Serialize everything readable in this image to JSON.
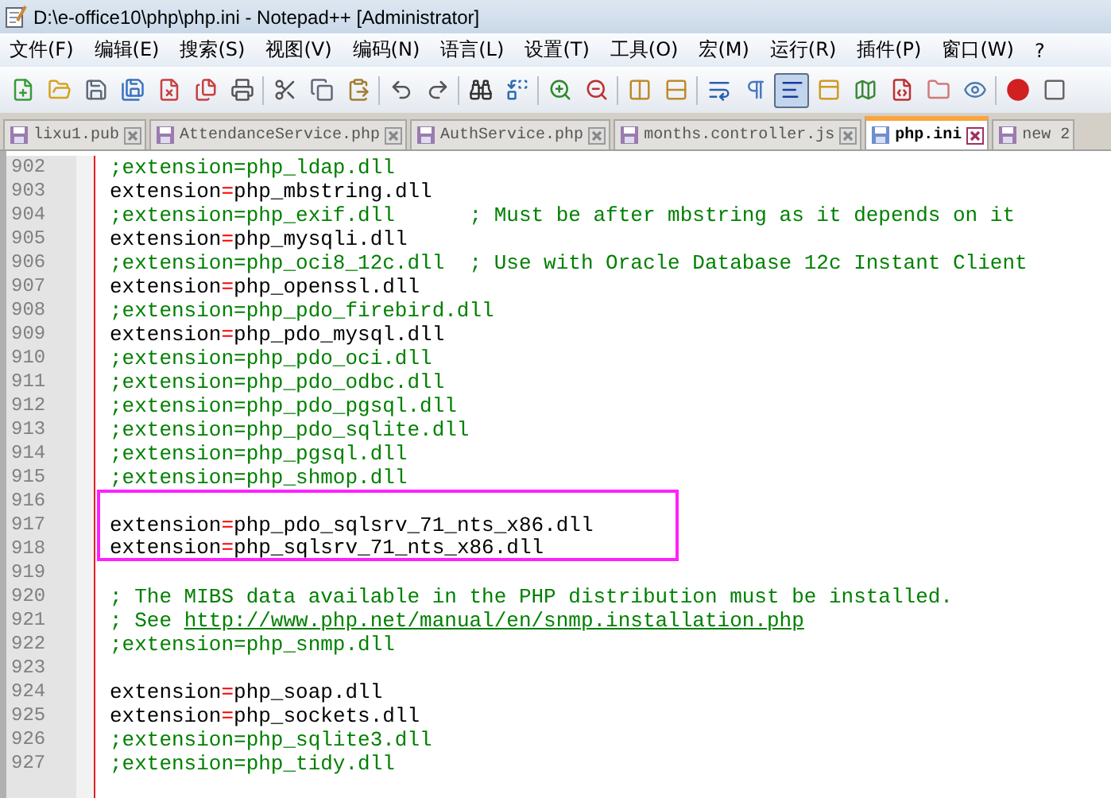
{
  "window": {
    "title": "D:\\e-office10\\php\\php.ini - Notepad++ [Administrator]"
  },
  "menu": [
    "文件(F)",
    "编辑(E)",
    "搜索(S)",
    "视图(V)",
    "编码(N)",
    "语言(L)",
    "设置(T)",
    "工具(O)",
    "宏(M)",
    "运行(R)",
    "插件(P)",
    "窗口(W)",
    "?"
  ],
  "toolbar": [
    {
      "pressed": false
    },
    {
      "pressed": false
    },
    {
      "pressed": false
    },
    {
      "pressed": false
    },
    {
      "pressed": false
    },
    {
      "pressed": false
    },
    {
      "pressed": false
    },
    {
      "pressed": false
    },
    {
      "pressed": false
    },
    {
      "pressed": false
    },
    {
      "pressed": false
    },
    {
      "pressed": false
    },
    {
      "pressed": false
    },
    {
      "pressed": false
    },
    {
      "pressed": false
    },
    {
      "pressed": false
    },
    {
      "pressed": false
    },
    {
      "pressed": false
    },
    {
      "pressed": false
    },
    {
      "pressed": false
    },
    {
      "pressed": true
    },
    {
      "pressed": false
    },
    {
      "pressed": false
    },
    {
      "pressed": false
    },
    {
      "pressed": false
    },
    {
      "pressed": false
    },
    {
      "pressed": false
    },
    {
      "pressed": false
    }
  ],
  "tabs": [
    {
      "label": "lixu1.pub",
      "selected": false
    },
    {
      "label": "AttendanceService.php",
      "selected": false
    },
    {
      "label": "AuthService.php",
      "selected": false
    },
    {
      "label": "months.controller.js",
      "selected": false
    },
    {
      "label": "php.ini",
      "selected": true
    },
    {
      "label": "new 2",
      "selected": false
    }
  ],
  "lines": [
    {
      "number": "902",
      "kind": "comment",
      "text": ";extension=php_ldap.dll",
      "boxed": false
    },
    {
      "number": "903",
      "kind": "setting",
      "key": "extension",
      "op": "=",
      "value": "php_mbstring.dll",
      "boxed": false
    },
    {
      "number": "904",
      "kind": "comment",
      "text": ";extension=php_exif.dll      ; Must be after mbstring as it depends on it",
      "boxed": false
    },
    {
      "number": "905",
      "kind": "setting",
      "key": "extension",
      "op": "=",
      "value": "php_mysqli.dll",
      "boxed": false
    },
    {
      "number": "906",
      "kind": "comment",
      "text": ";extension=php_oci8_12c.dll  ; Use with Oracle Database 12c Instant Client",
      "boxed": false
    },
    {
      "number": "907",
      "kind": "setting",
      "key": "extension",
      "op": "=",
      "value": "php_openssl.dll",
      "boxed": false
    },
    {
      "number": "908",
      "kind": "comment",
      "text": ";extension=php_pdo_firebird.dll",
      "boxed": false
    },
    {
      "number": "909",
      "kind": "setting",
      "key": "extension",
      "op": "=",
      "value": "php_pdo_mysql.dll",
      "boxed": false
    },
    {
      "number": "910",
      "kind": "comment",
      "text": ";extension=php_pdo_oci.dll",
      "boxed": false
    },
    {
      "number": "911",
      "kind": "comment",
      "text": ";extension=php_pdo_odbc.dll",
      "boxed": false
    },
    {
      "number": "912",
      "kind": "comment",
      "text": ";extension=php_pdo_pgsql.dll",
      "boxed": false
    },
    {
      "number": "913",
      "kind": "comment",
      "text": ";extension=php_pdo_sqlite.dll",
      "boxed": false
    },
    {
      "number": "914",
      "kind": "comment",
      "text": ";extension=php_pgsql.dll",
      "boxed": false
    },
    {
      "number": "915",
      "kind": "comment",
      "text": ";extension=php_shmop.dll",
      "boxed": false
    },
    {
      "number": "916",
      "kind": "blank",
      "boxed": true
    },
    {
      "number": "917",
      "kind": "setting",
      "key": "extension",
      "op": "=",
      "value": "php_pdo_sqlsrv_71_nts_x86.dll",
      "boxed": true
    },
    {
      "number": "918",
      "kind": "setting",
      "key": "extension",
      "op": "=",
      "value": "php_sqlsrv_71_nts_x86.dll",
      "boxed": true
    },
    {
      "number": "919",
      "kind": "blank",
      "boxed": false
    },
    {
      "number": "920",
      "kind": "comment",
      "text": "; The MIBS data available in the PHP distribution must be installed.",
      "boxed": false
    },
    {
      "number": "921",
      "kind": "comment",
      "text": "; See ",
      "link": "http://www.php.net/manual/en/snmp.installation.php",
      "boxed": false
    },
    {
      "number": "922",
      "kind": "comment",
      "text": ";extension=php_snmp.dll",
      "boxed": false
    },
    {
      "number": "923",
      "kind": "blank",
      "boxed": false
    },
    {
      "number": "924",
      "kind": "setting",
      "key": "extension",
      "op": "=",
      "value": "php_soap.dll",
      "boxed": false
    },
    {
      "number": "925",
      "kind": "setting",
      "key": "extension",
      "op": "=",
      "value": "php_sockets.dll",
      "boxed": false
    },
    {
      "number": "926",
      "kind": "comment",
      "text": ";extension=php_sqlite3.dll",
      "boxed": false
    },
    {
      "number": "927",
      "kind": "comment",
      "text": ";extension=php_tidy.dll",
      "boxed": false
    }
  ]
}
